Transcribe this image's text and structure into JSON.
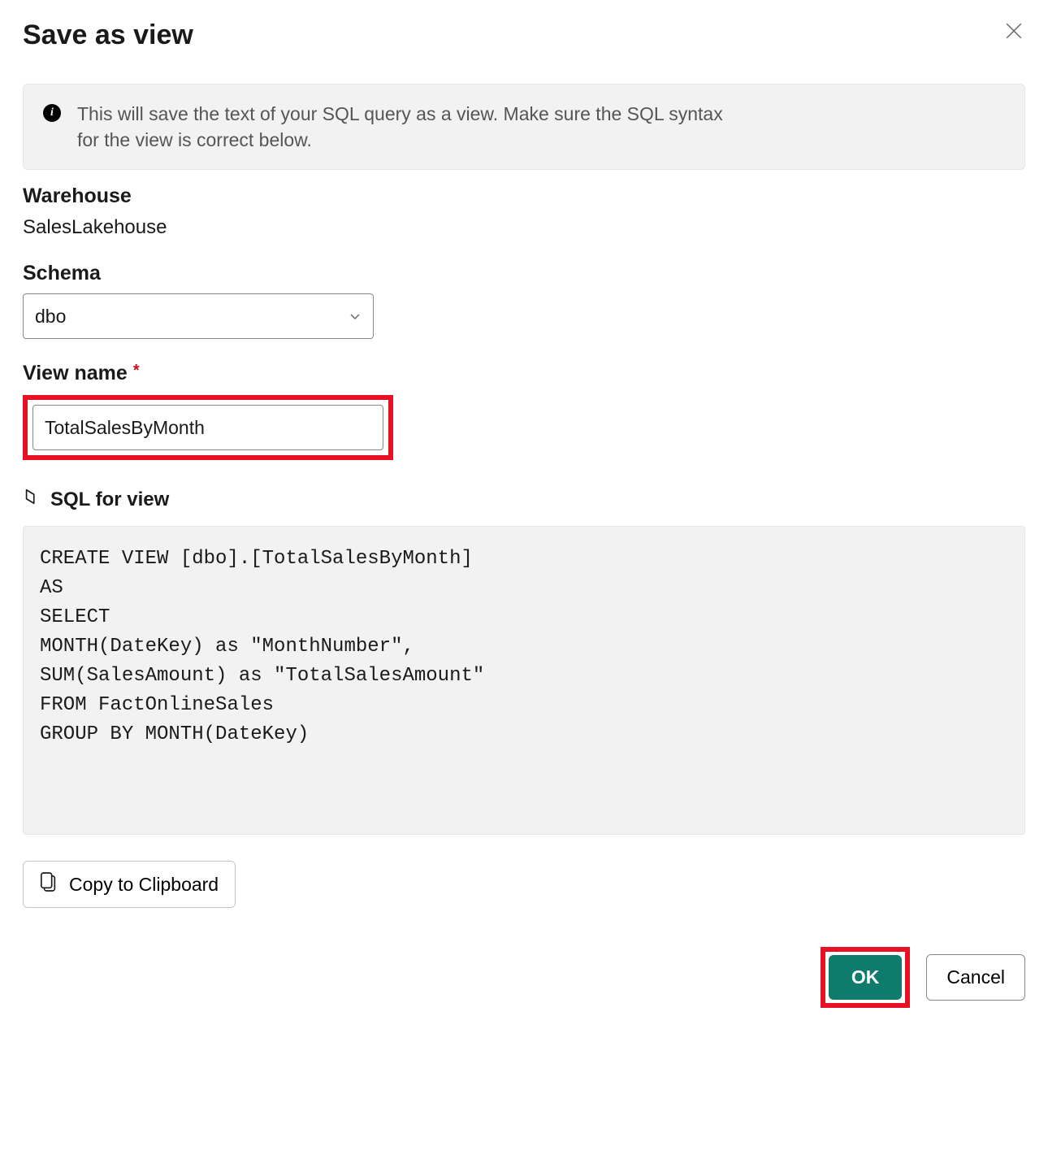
{
  "dialog": {
    "title": "Save as view",
    "info_text": "This will save the text of your SQL query as a view. Make sure the SQL syntax for the view is correct below."
  },
  "warehouse": {
    "label": "Warehouse",
    "value": "SalesLakehouse"
  },
  "schema": {
    "label": "Schema",
    "selected": "dbo"
  },
  "view_name": {
    "label": "View name",
    "value": "TotalSalesByMonth"
  },
  "sql_section": {
    "label": "SQL for view",
    "code": "CREATE VIEW [dbo].[TotalSalesByMonth]\nAS\nSELECT\nMONTH(DateKey) as \"MonthNumber\",\nSUM(SalesAmount) as \"TotalSalesAmount\"\nFROM FactOnlineSales\nGROUP BY MONTH(DateKey)"
  },
  "buttons": {
    "copy": "Copy to Clipboard",
    "ok": "OK",
    "cancel": "Cancel"
  }
}
